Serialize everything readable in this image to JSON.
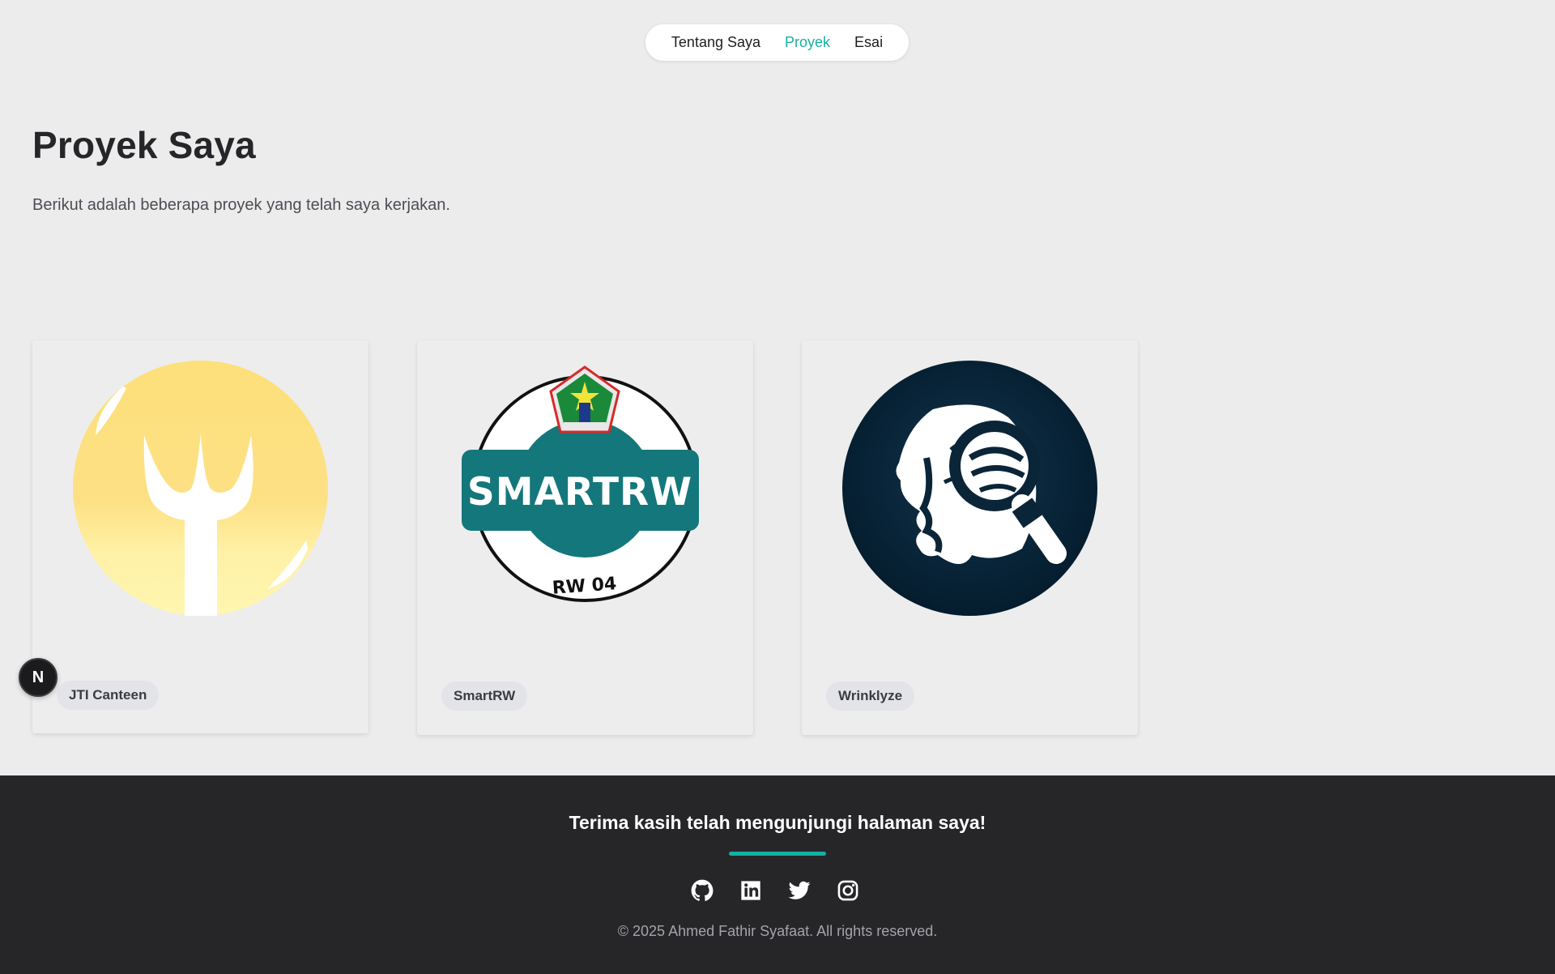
{
  "nav": {
    "items": [
      {
        "label": "Tentang Saya",
        "active": false
      },
      {
        "label": "Proyek",
        "active": true
      },
      {
        "label": "Esai",
        "active": false
      }
    ]
  },
  "heading": {
    "title": "Proyek Saya",
    "subtitle": "Berikut adalah beberapa proyek yang telah saya kerjakan."
  },
  "projects": [
    {
      "name": "JTI Canteen",
      "logo": "fork-icon",
      "colors": {
        "bg": "#fde27c",
        "glyph": "#ffffff"
      }
    },
    {
      "name": "SmartRW",
      "logo": "smartrw-logo",
      "logo_text": "SMARTRW",
      "logo_subtext": "RW 04",
      "colors": {
        "band": "#14777b",
        "ring": "#111111"
      }
    },
    {
      "name": "Wrinklyze",
      "logo": "magnifier-face-icon",
      "colors": {
        "bg": "#0b2538",
        "glyph": "#ffffff"
      }
    }
  ],
  "badge": {
    "label": "N"
  },
  "footer": {
    "thanks": "Terima kasih telah mengunjungi halaman saya!",
    "socials": [
      "github-icon",
      "linkedin-icon",
      "twitter-icon",
      "instagram-icon"
    ],
    "copyright": "© 2025 Ahmed Fathir Syafaat. All rights reserved."
  },
  "colors": {
    "accent": "#14b1a1",
    "background": "#ececec",
    "footer": "#262629"
  }
}
